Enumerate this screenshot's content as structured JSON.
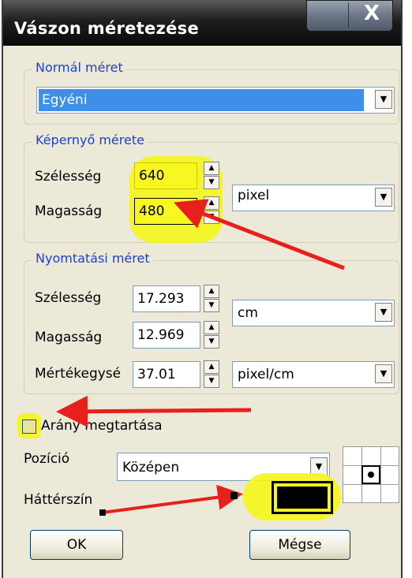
{
  "dialog": {
    "title": "Vászon méretezése",
    "close_glyph": "X"
  },
  "normal_size": {
    "legend": "Normál méret",
    "selected": "Egyéni"
  },
  "screen_size": {
    "legend": "Képernyő mérete",
    "width_label": "Szélesség",
    "width_value": "640",
    "height_label": "Magasság",
    "height_value": "480",
    "unit": "pixel"
  },
  "print_size": {
    "legend": "Nyomtatási méret",
    "width_label": "Szélesség",
    "width_value": "17.293",
    "height_label": "Magasság",
    "height_value": "12.969",
    "unit": "cm",
    "resolution_label": "Mértékegysé",
    "resolution_value": "37.01",
    "resolution_unit": "pixel/cm"
  },
  "keep_ratio": {
    "label": "Arány megtartása",
    "checked": false
  },
  "position": {
    "label": "Pozíció",
    "selected": "Középen"
  },
  "background": {
    "label": "Háttérszín",
    "color": "#000000"
  },
  "buttons": {
    "ok": "OK",
    "cancel": "Mégse"
  },
  "annotation": {
    "highlight_color": "#f5f51e",
    "arrow_color": "#e8201c"
  }
}
